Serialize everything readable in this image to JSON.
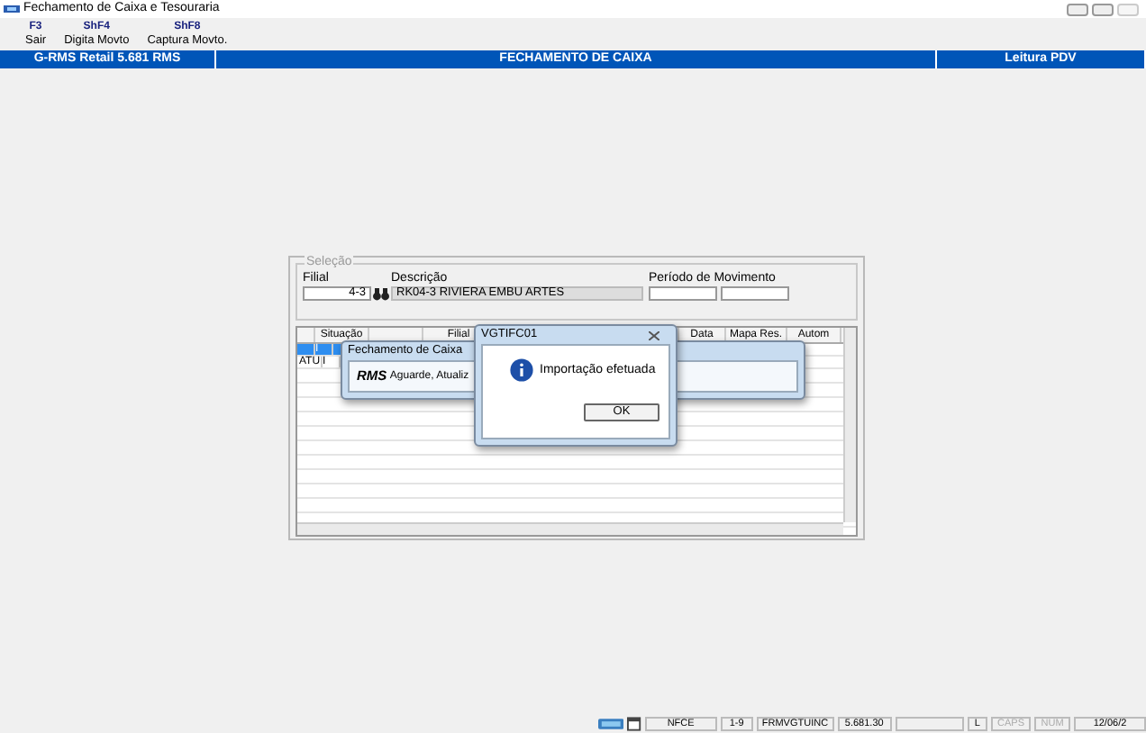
{
  "window": {
    "title": "Fechamento de Caixa e Tesouraria"
  },
  "toolbar": [
    {
      "key": "F3",
      "label": "Sair"
    },
    {
      "key": "ShF4",
      "label": "Digita Movto"
    },
    {
      "key": "ShF8",
      "label": "Captura Movto."
    }
  ],
  "header": [
    "G-RMS Retail 5.681 RMS",
    "FECHAMENTO DE CAIXA",
    "Leitura PDV"
  ],
  "selection": {
    "title": "Seleção",
    "filial_label": "Filial",
    "filial_value": "4-3",
    "descricao_label": "Descrição",
    "descricao_value": "RK04-3 RIVIERA EMBU ARTES",
    "periodo_label": "Período de Movimento"
  },
  "grid": {
    "columns": [
      "Situação",
      "Filial",
      "Data",
      "Mapa Res.",
      "Autom"
    ],
    "rows": [
      {
        "selected": true,
        "situacao": "I"
      },
      {
        "selected": false,
        "code": "ATU",
        "situacao": "I"
      }
    ]
  },
  "dialogs": [
    {
      "title": "Fechamento de Caixa",
      "logo": "RMS",
      "message": "Aguarde, Atualiz"
    },
    {
      "title": "VGTIFC01",
      "message": "Importação efetuada",
      "button": "OK"
    }
  ],
  "status_bar": [
    {
      "text": "NFCE",
      "disabled": false
    },
    {
      "text": "1-9",
      "disabled": false
    },
    {
      "text": "FRMVGTUINC",
      "disabled": false
    },
    {
      "text": "5.681.30",
      "disabled": false
    },
    {
      "text": "L",
      "disabled": false
    },
    {
      "text": "CAPS",
      "disabled": true
    },
    {
      "text": "NUM",
      "disabled": true
    },
    {
      "text": "12/06/2",
      "disabled": false
    }
  ]
}
